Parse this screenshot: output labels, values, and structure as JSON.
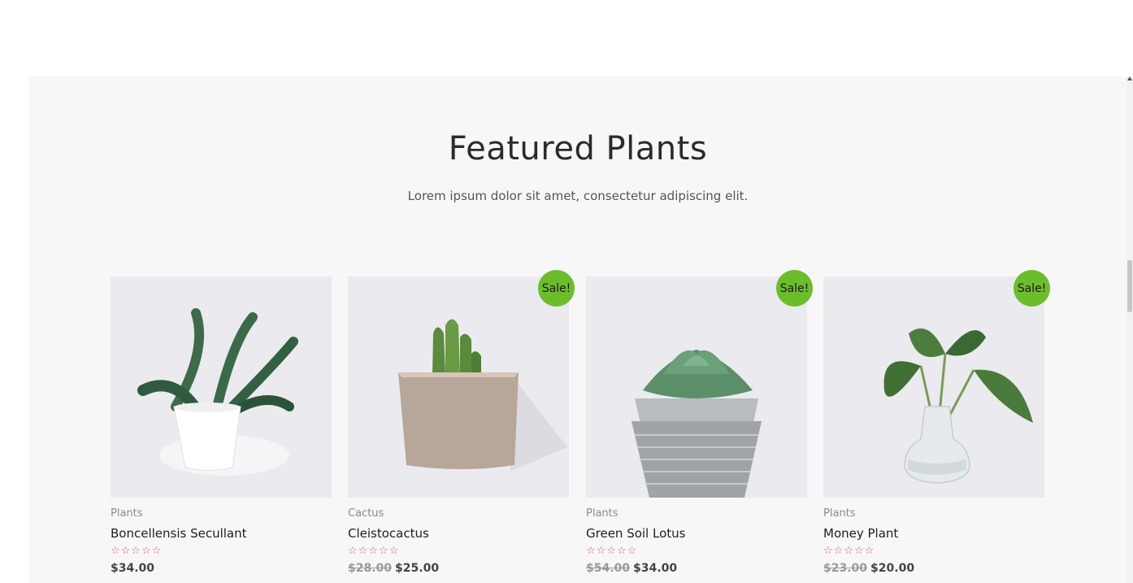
{
  "section": {
    "title": "Featured Plants",
    "subtitle": "Lorem ipsum dolor sit amet, consectetur adipiscing elit."
  },
  "products": [
    {
      "category": "Plants",
      "name": "Boncellensis Secullant",
      "stars": "☆☆☆☆☆",
      "rating": 0,
      "old_price": "",
      "price": "$34.00",
      "sale": false,
      "sale_label": ""
    },
    {
      "category": "Cactus",
      "name": "Cleistocactus",
      "stars": "☆☆☆☆☆",
      "rating": 0,
      "old_price": "$28.00",
      "price": "$25.00",
      "sale": true,
      "sale_label": "Sale!"
    },
    {
      "category": "Plants",
      "name": "Green Soil Lotus",
      "stars": "☆☆☆☆☆",
      "rating": 0,
      "old_price": "$54.00",
      "price": "$34.00",
      "sale": true,
      "sale_label": "Sale!"
    },
    {
      "category": "Plants",
      "name": "Money Plant",
      "stars": "☆☆☆☆☆",
      "rating": 0,
      "old_price": "$23.00",
      "price": "$20.00",
      "sale": true,
      "sale_label": "Sale!"
    }
  ],
  "colors": {
    "sale_badge": "#6cbd2c",
    "stars": "#e05a6b",
    "background": "#f7f7f7"
  }
}
